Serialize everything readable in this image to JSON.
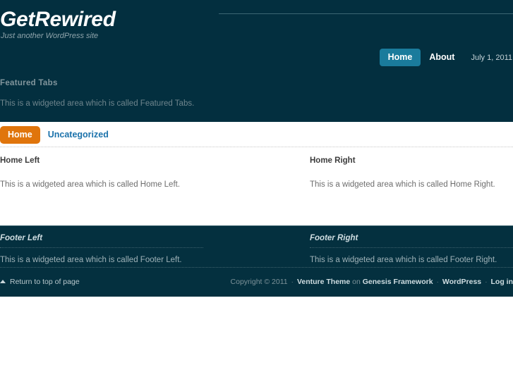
{
  "header": {
    "site_title": "GetRewired",
    "tagline": "Just another WordPress site",
    "nav": [
      {
        "label": "Home",
        "current": true
      },
      {
        "label": "About",
        "current": false
      }
    ],
    "date": "July 1, 2011"
  },
  "featured": {
    "title": "Featured Tabs",
    "text": "This is a widgeted area which is called Featured Tabs."
  },
  "subnav": [
    {
      "label": "Home",
      "current": true
    },
    {
      "label": "Uncategorized",
      "current": false
    }
  ],
  "main": {
    "left": {
      "title": "Home Left",
      "text": "This is a widgeted area which is called Home Left."
    },
    "right": {
      "title": "Home Right",
      "text": "This is a widgeted area which is called Home Right."
    }
  },
  "footer_widgets": {
    "left": {
      "title": "Footer Left",
      "text": "This is a widgeted area which is called Footer Left."
    },
    "right": {
      "title": "Footer Right",
      "text": "This is a widgeted area which is called Footer Right."
    }
  },
  "footer_bar": {
    "return_top": "Return to top of page",
    "credits": {
      "copyright": "Copyright © 2011",
      "sep1": "·",
      "theme": "Venture Theme",
      "on": "on",
      "framework": "Genesis Framework",
      "sep2": "·",
      "wordpress": "WordPress",
      "sep3": "·",
      "login": "Log in"
    }
  },
  "colors": {
    "dark_teal": "#032f3f",
    "nav_active": "#1a7b9c",
    "subnav_active": "#e0750c",
    "link_blue": "#1b72ab"
  }
}
